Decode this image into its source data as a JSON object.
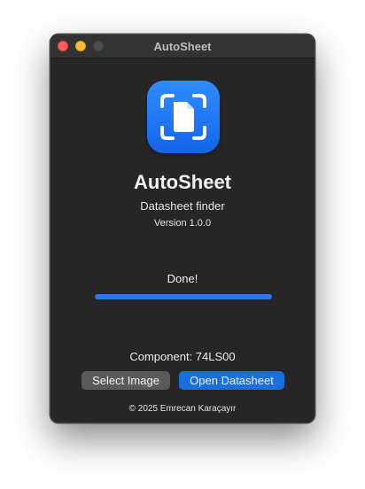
{
  "window": {
    "title": "AutoSheet"
  },
  "app": {
    "icon": "document-scan-icon",
    "name": "AutoSheet",
    "subtitle": "Datasheet finder",
    "version": "Version 1.0.0"
  },
  "status": {
    "text": "Done!",
    "progress": 1.0
  },
  "result": {
    "component": "Component: 74LS00"
  },
  "buttons": {
    "select_image": "Select Image",
    "open_datasheet": "Open Datasheet"
  },
  "footer": {
    "copyright": "© 2025 Emrecan Karaçayır"
  },
  "colors": {
    "accent": "#1a6fe0",
    "progress": "#2f76e8",
    "window_bg": "#262626"
  }
}
